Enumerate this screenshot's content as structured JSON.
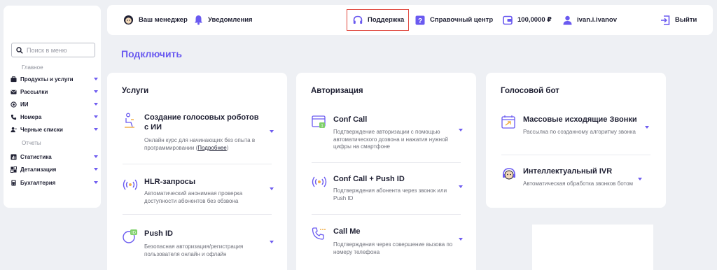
{
  "sidebar": {
    "search_placeholder": "Поиск в меню",
    "group_main": "Главное",
    "group_reports": "Отчеты",
    "items": [
      {
        "label": "Продукты и услуги"
      },
      {
        "label": "Рассылки"
      },
      {
        "label": "ИИ"
      },
      {
        "label": "Номера"
      },
      {
        "label": "Черные списки"
      },
      {
        "label": "Статистика"
      },
      {
        "label": "Детализация"
      },
      {
        "label": "Бухгалтерия"
      }
    ]
  },
  "topbar": {
    "manager": "Ваш менеджер",
    "notifications": "Уведомления",
    "support": "Поддержка",
    "help_center": "Справочный центр",
    "balance": "100,0000 ₽",
    "user": "ivan.i.ivanov",
    "logout": "Выйти"
  },
  "page_title": "Подключить",
  "cards": [
    {
      "title": "Услуги",
      "services": [
        {
          "title": "Создание голосовых роботов с ИИ",
          "desc": "Онлайн курс для начинающих без опыта в программировании (",
          "link": "Подробнее",
          "desc_end": ")"
        },
        {
          "title": "HLR-запросы",
          "desc": "Автоматический анонимная проверка доступности абонентов без обзвона"
        },
        {
          "title": "Push ID",
          "desc": "Безопасная авторизация/регистрация пользователя онлайн и офлайн"
        }
      ]
    },
    {
      "title": "Авторизация",
      "services": [
        {
          "title": "Conf Call",
          "desc": "Подтверждение авторизации с помощью автоматического дозвона и нажатия нужной цифры на смартфоне"
        },
        {
          "title": "Conf Call + Push ID",
          "desc": "Подтверждения абонента через звонок или Push ID"
        },
        {
          "title": "Call Me",
          "desc": "Подтверждения через совершение вызова по номеру телефона"
        }
      ]
    },
    {
      "title": "Голосовой бот",
      "services": [
        {
          "title": "Массовые исходящие Звонки",
          "desc": "Рассылка по созданному алгоритму звонка"
        },
        {
          "title": "Интеллектуальный IVR",
          "desc": "Автоматическая обработка звонков ботом"
        }
      ]
    }
  ],
  "colors": {
    "accent": "#6a5af0",
    "highlight": "#e0463c",
    "background": "#eef0f4"
  }
}
